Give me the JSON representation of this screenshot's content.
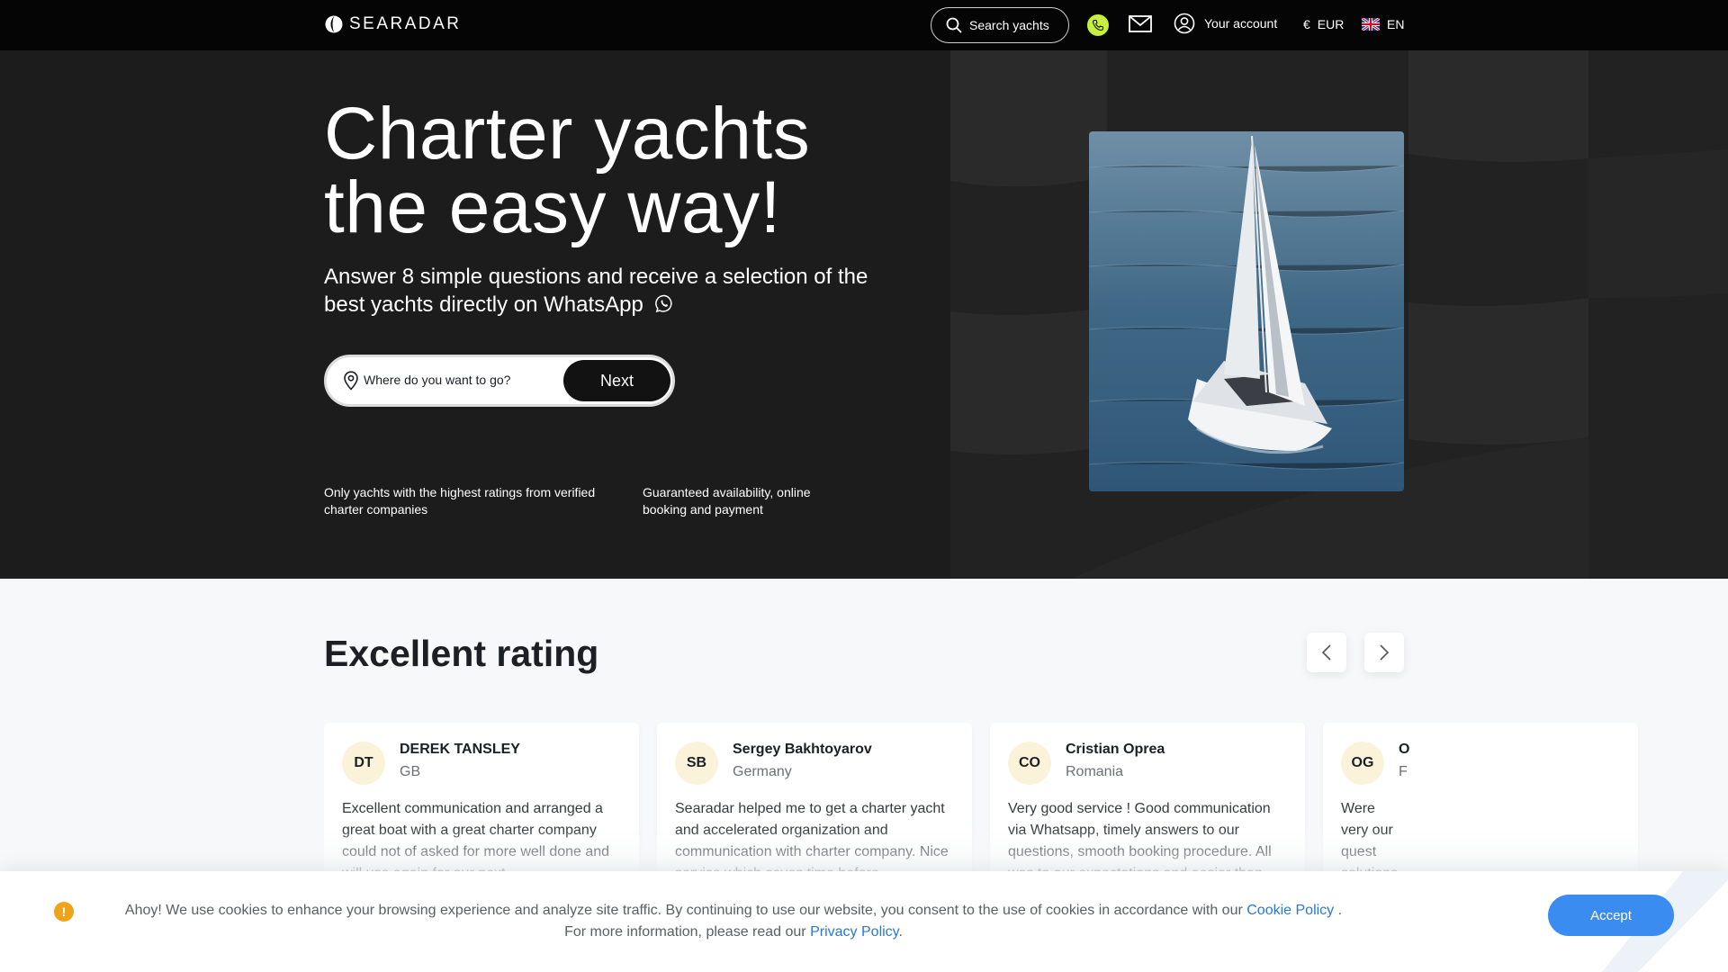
{
  "header": {
    "logo_text": "SEARADAR",
    "search_label": "Search yachts",
    "account_label": "Your account",
    "currency_symbol": "€",
    "currency": "EUR",
    "language": "EN"
  },
  "hero": {
    "title_line1": "Charter yachts",
    "title_line2": "the easy way!",
    "subtitle": "Answer 8 simple questions and receive a selection of the best yachts directly on WhatsApp",
    "destination_placeholder": "Where do you want to go?",
    "next_label": "Next",
    "features": [
      "Only yachts with the highest ratings from verified charter companies",
      "Guaranteed availability, online booking and payment"
    ]
  },
  "ratings": {
    "title": "Excellent rating",
    "reviews": [
      {
        "initials": "DT",
        "name": "DEREK TANSLEY",
        "country": "GB",
        "text": "Excellent communication and arranged a great boat with a great charter company could not of asked for more well done and will use again for our next"
      },
      {
        "initials": "SB",
        "name": "Sergey Bakhtoyarov",
        "country": "Germany",
        "text": "Searadar helped me to get a charter yacht and accelerated organization and communication with charter company. Nice service which saves time before"
      },
      {
        "initials": "CO",
        "name": "Cristian Oprea",
        "country": "Romania",
        "text": "Very good service ! Good communication via Whatsapp, timely answers to our questions, smooth booking procedure. All was to our expectations and easier than"
      },
      {
        "initials": "OG",
        "name": "O",
        "country": "F",
        "text": "Were very our quest solutions which"
      }
    ]
  },
  "cookie": {
    "text_before": "Ahoy! We use cookies to enhance your browsing experience and analyze site traffic. By continuing to use our website, you consent to the use of cookies in accordance with our",
    "cookie_link": "Cookie Policy",
    "text_middle": ". For more information, please read our",
    "privacy_link": "Privacy Policy",
    "text_end": ".",
    "accept_label": "Accept"
  },
  "colors": {
    "topbar": "#050505",
    "hero_bg": "#1c1c1d",
    "phone_accent": "#c8ef3b",
    "accept_button": "#3a8cf0",
    "link": "#2a78d4",
    "alert": "#f0a31a",
    "avatar_bg": "#faf3d9"
  },
  "icons": [
    "logo-icon",
    "search-icon",
    "phone-icon",
    "mail-icon",
    "user-icon",
    "uk-flag-icon",
    "whatsapp-icon",
    "location-pin-icon",
    "chevron-left-icon",
    "chevron-right-icon",
    "alert-icon"
  ]
}
